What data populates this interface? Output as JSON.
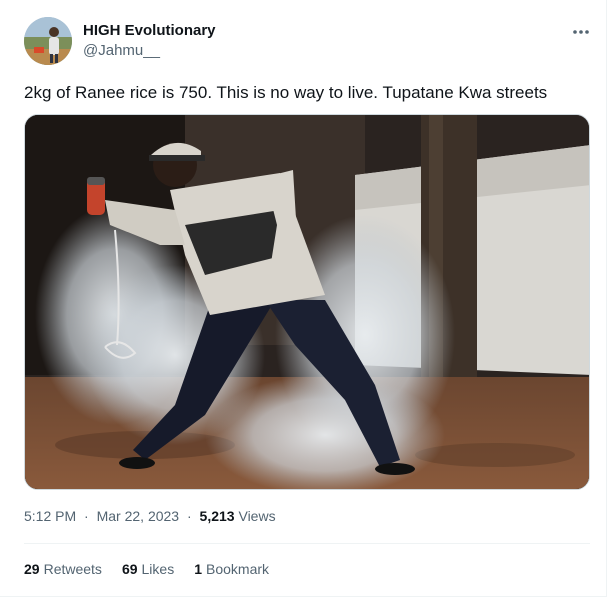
{
  "author": {
    "name": "HIGH Evolutionary",
    "handle": "@Jahmu__"
  },
  "tweet": {
    "text": "2kg of Ranee rice is 750. This is no way to live. Tupatane Kwa streets"
  },
  "media": {
    "icon": "photo-of-man-throwing-tear-gas-canister"
  },
  "meta": {
    "time": "5:12 PM",
    "separator": "·",
    "date": "Mar 22, 2023",
    "views_count": "5,213",
    "views_label": "Views"
  },
  "stats": {
    "retweets_count": "29",
    "retweets_label": "Retweets",
    "likes_count": "69",
    "likes_label": "Likes",
    "bookmarks_count": "1",
    "bookmarks_label": "Bookmark"
  },
  "icons": {
    "more": "more-dots-icon"
  },
  "colors": {
    "text_primary": "#0f1419",
    "text_secondary": "#536471",
    "divider": "#eff3f4"
  }
}
